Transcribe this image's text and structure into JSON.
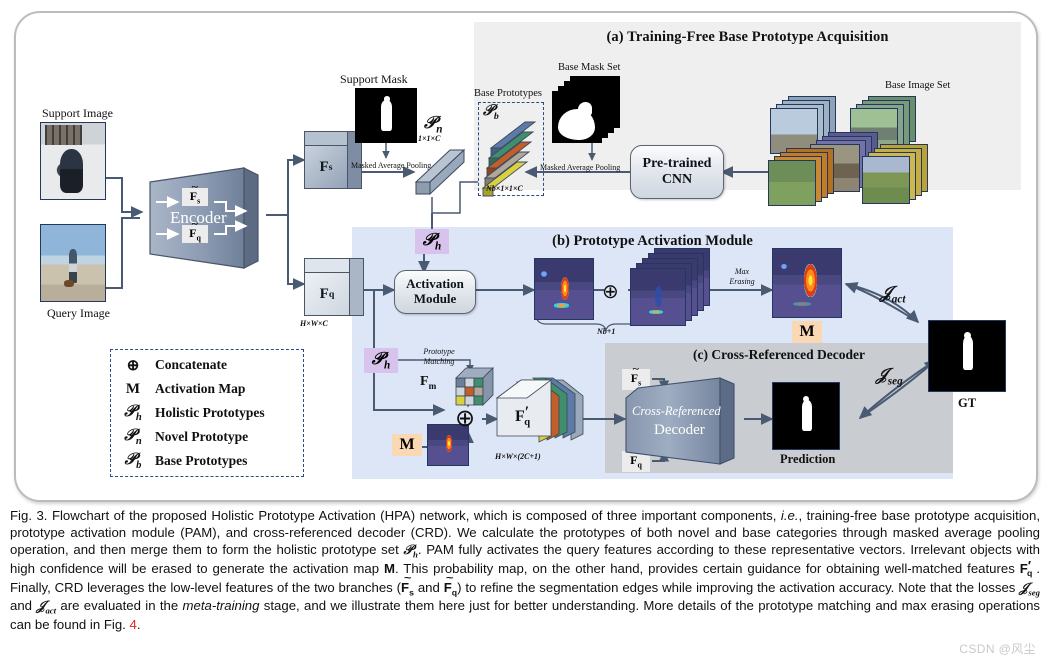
{
  "figure": {
    "panels": {
      "a": {
        "title": "(a) Training-Free Base Prototype Acquisition"
      },
      "b": {
        "title": "(b) Prototype Activation Module"
      },
      "c": {
        "title": "(c) Cross-Referenced Decoder"
      }
    },
    "inputs": {
      "support_image_label": "Support Image",
      "query_image_label": "Query Image",
      "support_mask_label": "Support Mask"
    },
    "encoder": {
      "label": "Encoder",
      "feature_support": "F̃s",
      "feature_query": "F̃q"
    },
    "features": {
      "fs": "Fs",
      "fq": "Fq",
      "fq_dims": "H×W×C",
      "fm": "Fm",
      "fq_prime": "F′q",
      "fq_prime_dims": "H×W×(2C+1)"
    },
    "panel_a": {
      "base_prototypes_label": "Base Prototypes",
      "base_prototypes_symbol": "Pb",
      "base_prototypes_dims": "Nb×1×1×C",
      "base_mask_set_label": "Base Mask Set",
      "base_image_set_label": "Base Image Set",
      "masked_average_pooling": "Masked  Average Pooling",
      "cnn_box": "Pre-trained CNN"
    },
    "prototypes": {
      "novel_symbol": "Pn",
      "novel_dims": "1×1×C",
      "holistic_symbol": "Ph",
      "masked_average_pooling": "Masked  Average Pooling"
    },
    "panel_b": {
      "activation_module": "Activation Module",
      "concat_count": "Nb+1",
      "max_erasing": "Max Erasing",
      "activation_map_symbol": "M",
      "prototype_matching": "Prototype Matching"
    },
    "panel_c": {
      "decoder_line1": "Cross-Referenced",
      "decoder_line2": "Decoder",
      "feature_support": "F̃s",
      "feature_query": "F̃q",
      "prediction_label": "Prediction"
    },
    "outputs": {
      "gt_label": "GT",
      "loss_act": "Jact",
      "loss_seg": "Jseg"
    },
    "legend": {
      "items": [
        {
          "symbol": "⊕",
          "label": "Concatenate"
        },
        {
          "symbol": "M",
          "label": "Activation Map"
        },
        {
          "symbol": "Ph",
          "label": "Holistic Prototypes"
        },
        {
          "symbol": "Pn",
          "label": "Novel Prototype"
        },
        {
          "symbol": "Pb",
          "label": "Base Prototypes"
        }
      ]
    }
  },
  "caption": {
    "text_part1": "Fig. 3. Flowchart of the proposed Holistic Prototype Activation (HPA) network, which is composed of three important components, ",
    "ie": "i.e.",
    "text_part2": ", training-free base prototype acquisition, prototype activation module (PAM), and cross-referenced decoder (CRD). We calculate the prototypes of both novel and base categories through masked average pooling operation, and then merge them to form the holistic prototype set ",
    "ph": "Ph",
    "text_part3": ". PAM fully activates the query features according to these representative vectors. Irrelevant objects with high confidence will be erased to generate the activation map ",
    "m": "M",
    "text_part4": ". This probability map, on the other hand, provides certain guidance for obtaining well-matched features ",
    "fqp": "F′q",
    "text_part5": ". Finally, CRD leverages the low-level features of the two branches (",
    "fs_tilde": "F̃s",
    "and": " and ",
    "fq_tilde": "F̃q",
    "text_part6": ") to refine the segmentation edges while improving the activation accuracy. Note that the losses ",
    "jseg": "Jseg",
    "text_part7": " and ",
    "jact": "Jact",
    "text_part8": " are evaluated in the ",
    "meta_training": "meta-training",
    "text_part9": " stage, and we illustrate them here just for better understanding. More details of the prototype matching and max erasing operations can be found in Fig. ",
    "fig_ref": "4",
    "period": "."
  },
  "watermark": {
    "text": "CSDN @风尘"
  },
  "colors": {
    "panel_a_bg": "#efefef",
    "panel_b_bg": "#dce6f7",
    "panel_c_bg": "#c9ccd1",
    "chip_prototype": "#d8c3ec",
    "chip_map": "#fbd8b4",
    "arrow": "#4a5a72",
    "border_dashed": "#2b4a86",
    "fig_ref_red": "#e8241c"
  }
}
